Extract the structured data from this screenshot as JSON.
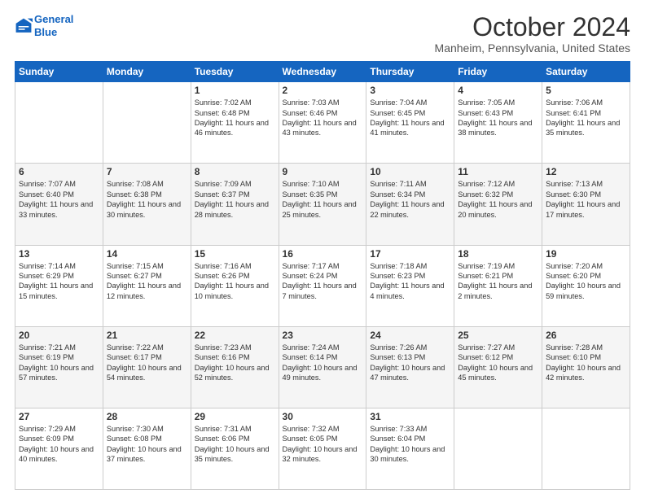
{
  "header": {
    "logo_line1": "General",
    "logo_line2": "Blue",
    "title": "October 2024",
    "location": "Manheim, Pennsylvania, United States"
  },
  "weekdays": [
    "Sunday",
    "Monday",
    "Tuesday",
    "Wednesday",
    "Thursday",
    "Friday",
    "Saturday"
  ],
  "weeks": [
    [
      {
        "day": "",
        "content": ""
      },
      {
        "day": "",
        "content": ""
      },
      {
        "day": "1",
        "content": "Sunrise: 7:02 AM\nSunset: 6:48 PM\nDaylight: 11 hours and 46 minutes."
      },
      {
        "day": "2",
        "content": "Sunrise: 7:03 AM\nSunset: 6:46 PM\nDaylight: 11 hours and 43 minutes."
      },
      {
        "day": "3",
        "content": "Sunrise: 7:04 AM\nSunset: 6:45 PM\nDaylight: 11 hours and 41 minutes."
      },
      {
        "day": "4",
        "content": "Sunrise: 7:05 AM\nSunset: 6:43 PM\nDaylight: 11 hours and 38 minutes."
      },
      {
        "day": "5",
        "content": "Sunrise: 7:06 AM\nSunset: 6:41 PM\nDaylight: 11 hours and 35 minutes."
      }
    ],
    [
      {
        "day": "6",
        "content": "Sunrise: 7:07 AM\nSunset: 6:40 PM\nDaylight: 11 hours and 33 minutes."
      },
      {
        "day": "7",
        "content": "Sunrise: 7:08 AM\nSunset: 6:38 PM\nDaylight: 11 hours and 30 minutes."
      },
      {
        "day": "8",
        "content": "Sunrise: 7:09 AM\nSunset: 6:37 PM\nDaylight: 11 hours and 28 minutes."
      },
      {
        "day": "9",
        "content": "Sunrise: 7:10 AM\nSunset: 6:35 PM\nDaylight: 11 hours and 25 minutes."
      },
      {
        "day": "10",
        "content": "Sunrise: 7:11 AM\nSunset: 6:34 PM\nDaylight: 11 hours and 22 minutes."
      },
      {
        "day": "11",
        "content": "Sunrise: 7:12 AM\nSunset: 6:32 PM\nDaylight: 11 hours and 20 minutes."
      },
      {
        "day": "12",
        "content": "Sunrise: 7:13 AM\nSunset: 6:30 PM\nDaylight: 11 hours and 17 minutes."
      }
    ],
    [
      {
        "day": "13",
        "content": "Sunrise: 7:14 AM\nSunset: 6:29 PM\nDaylight: 11 hours and 15 minutes."
      },
      {
        "day": "14",
        "content": "Sunrise: 7:15 AM\nSunset: 6:27 PM\nDaylight: 11 hours and 12 minutes."
      },
      {
        "day": "15",
        "content": "Sunrise: 7:16 AM\nSunset: 6:26 PM\nDaylight: 11 hours and 10 minutes."
      },
      {
        "day": "16",
        "content": "Sunrise: 7:17 AM\nSunset: 6:24 PM\nDaylight: 11 hours and 7 minutes."
      },
      {
        "day": "17",
        "content": "Sunrise: 7:18 AM\nSunset: 6:23 PM\nDaylight: 11 hours and 4 minutes."
      },
      {
        "day": "18",
        "content": "Sunrise: 7:19 AM\nSunset: 6:21 PM\nDaylight: 11 hours and 2 minutes."
      },
      {
        "day": "19",
        "content": "Sunrise: 7:20 AM\nSunset: 6:20 PM\nDaylight: 10 hours and 59 minutes."
      }
    ],
    [
      {
        "day": "20",
        "content": "Sunrise: 7:21 AM\nSunset: 6:19 PM\nDaylight: 10 hours and 57 minutes."
      },
      {
        "day": "21",
        "content": "Sunrise: 7:22 AM\nSunset: 6:17 PM\nDaylight: 10 hours and 54 minutes."
      },
      {
        "day": "22",
        "content": "Sunrise: 7:23 AM\nSunset: 6:16 PM\nDaylight: 10 hours and 52 minutes."
      },
      {
        "day": "23",
        "content": "Sunrise: 7:24 AM\nSunset: 6:14 PM\nDaylight: 10 hours and 49 minutes."
      },
      {
        "day": "24",
        "content": "Sunrise: 7:26 AM\nSunset: 6:13 PM\nDaylight: 10 hours and 47 minutes."
      },
      {
        "day": "25",
        "content": "Sunrise: 7:27 AM\nSunset: 6:12 PM\nDaylight: 10 hours and 45 minutes."
      },
      {
        "day": "26",
        "content": "Sunrise: 7:28 AM\nSunset: 6:10 PM\nDaylight: 10 hours and 42 minutes."
      }
    ],
    [
      {
        "day": "27",
        "content": "Sunrise: 7:29 AM\nSunset: 6:09 PM\nDaylight: 10 hours and 40 minutes."
      },
      {
        "day": "28",
        "content": "Sunrise: 7:30 AM\nSunset: 6:08 PM\nDaylight: 10 hours and 37 minutes."
      },
      {
        "day": "29",
        "content": "Sunrise: 7:31 AM\nSunset: 6:06 PM\nDaylight: 10 hours and 35 minutes."
      },
      {
        "day": "30",
        "content": "Sunrise: 7:32 AM\nSunset: 6:05 PM\nDaylight: 10 hours and 32 minutes."
      },
      {
        "day": "31",
        "content": "Sunrise: 7:33 AM\nSunset: 6:04 PM\nDaylight: 10 hours and 30 minutes."
      },
      {
        "day": "",
        "content": ""
      },
      {
        "day": "",
        "content": ""
      }
    ]
  ]
}
